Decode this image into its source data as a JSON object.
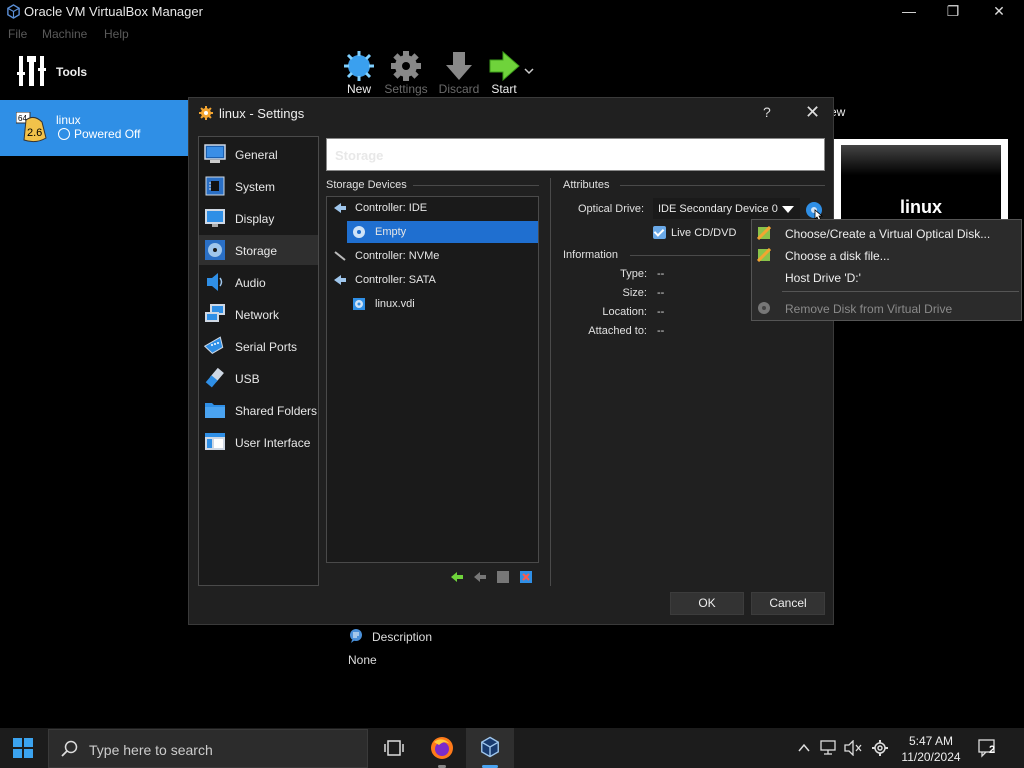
{
  "window": {
    "title": "Oracle VM VirtualBox Manager",
    "menu": [
      "File",
      "Machine",
      "Help"
    ]
  },
  "sidebar": {
    "tools_label": "Tools",
    "vm_name": "linux",
    "vm_state": "Powered Off",
    "vm_badge": "2.6",
    "vm_badge_top": "64"
  },
  "toolbar": {
    "new": "New",
    "settings": "Settings",
    "discard": "Discard",
    "start": "Start"
  },
  "preview": {
    "label": "ew",
    "vm_name": "linux"
  },
  "description": {
    "header": "Description",
    "value": "None"
  },
  "dialog": {
    "title": "linux - Settings",
    "help": "?",
    "categories": [
      "General",
      "System",
      "Display",
      "Storage",
      "Audio",
      "Network",
      "Serial Ports",
      "USB",
      "Shared Folders",
      "User Interface"
    ],
    "page_title": "Storage",
    "storage_devices_label": "Storage Devices",
    "attributes_label": "Attributes",
    "information_label": "Information",
    "tree": {
      "ide": "Controller: IDE",
      "empty": "Empty",
      "nvme": "Controller: NVMe",
      "sata": "Controller: SATA",
      "vdi": "linux.vdi"
    },
    "optical_drive_label": "Optical Drive:",
    "optical_drive_value": "IDE Secondary Device 0",
    "live_cd": "Live CD/DVD",
    "info": {
      "type_label": "Type:",
      "size_label": "Size:",
      "location_label": "Location:",
      "attached_label": "Attached to:",
      "type": "--",
      "size": "--",
      "location": "--",
      "attached": "--"
    },
    "ok": "OK",
    "cancel": "Cancel"
  },
  "popup": {
    "items": [
      "Choose/Create a Virtual Optical Disk...",
      "Choose a disk file...",
      "Host Drive 'D:'",
      "Remove Disk from Virtual Drive"
    ]
  },
  "taskbar": {
    "search_placeholder": "Type here to search",
    "time": "5:47 AM",
    "date": "11/20/2024",
    "notifications": "2"
  }
}
